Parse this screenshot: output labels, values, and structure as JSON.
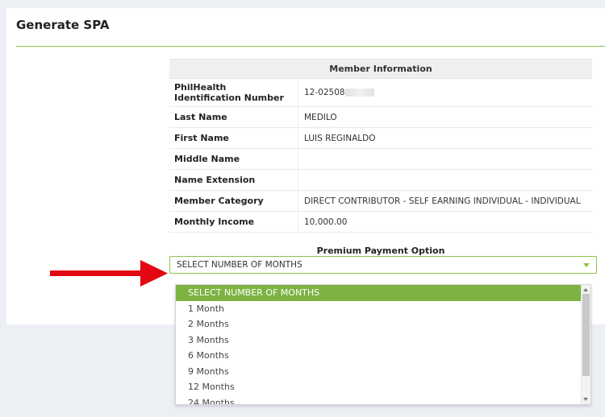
{
  "page": {
    "title": "Generate SPA"
  },
  "member_info": {
    "header": "Member Information",
    "rows": [
      {
        "label": "PhilHealth Identification Number",
        "value": "12-02508"
      },
      {
        "label": "Last Name",
        "value": "MEDILO"
      },
      {
        "label": "First Name",
        "value": "LUIS REGINALDO"
      },
      {
        "label": "Middle Name",
        "value": ""
      },
      {
        "label": "Name Extension",
        "value": ""
      },
      {
        "label": "Member Category",
        "value": "DIRECT CONTRIBUTOR - SELF EARNING INDIVIDUAL - INDIVIDUAL"
      },
      {
        "label": "Monthly Income",
        "value": "10,000.00"
      }
    ]
  },
  "premium_payment": {
    "title": "Premium Payment Option",
    "selected": "SELECT NUMBER OF MONTHS",
    "options": [
      "SELECT NUMBER OF MONTHS",
      "1 Month",
      "2 Months",
      "3 Months",
      "6 Months",
      "9 Months",
      "12 Months",
      "24 Months"
    ]
  },
  "colors": {
    "accent": "#7cb342",
    "arrow": "#e30613"
  }
}
